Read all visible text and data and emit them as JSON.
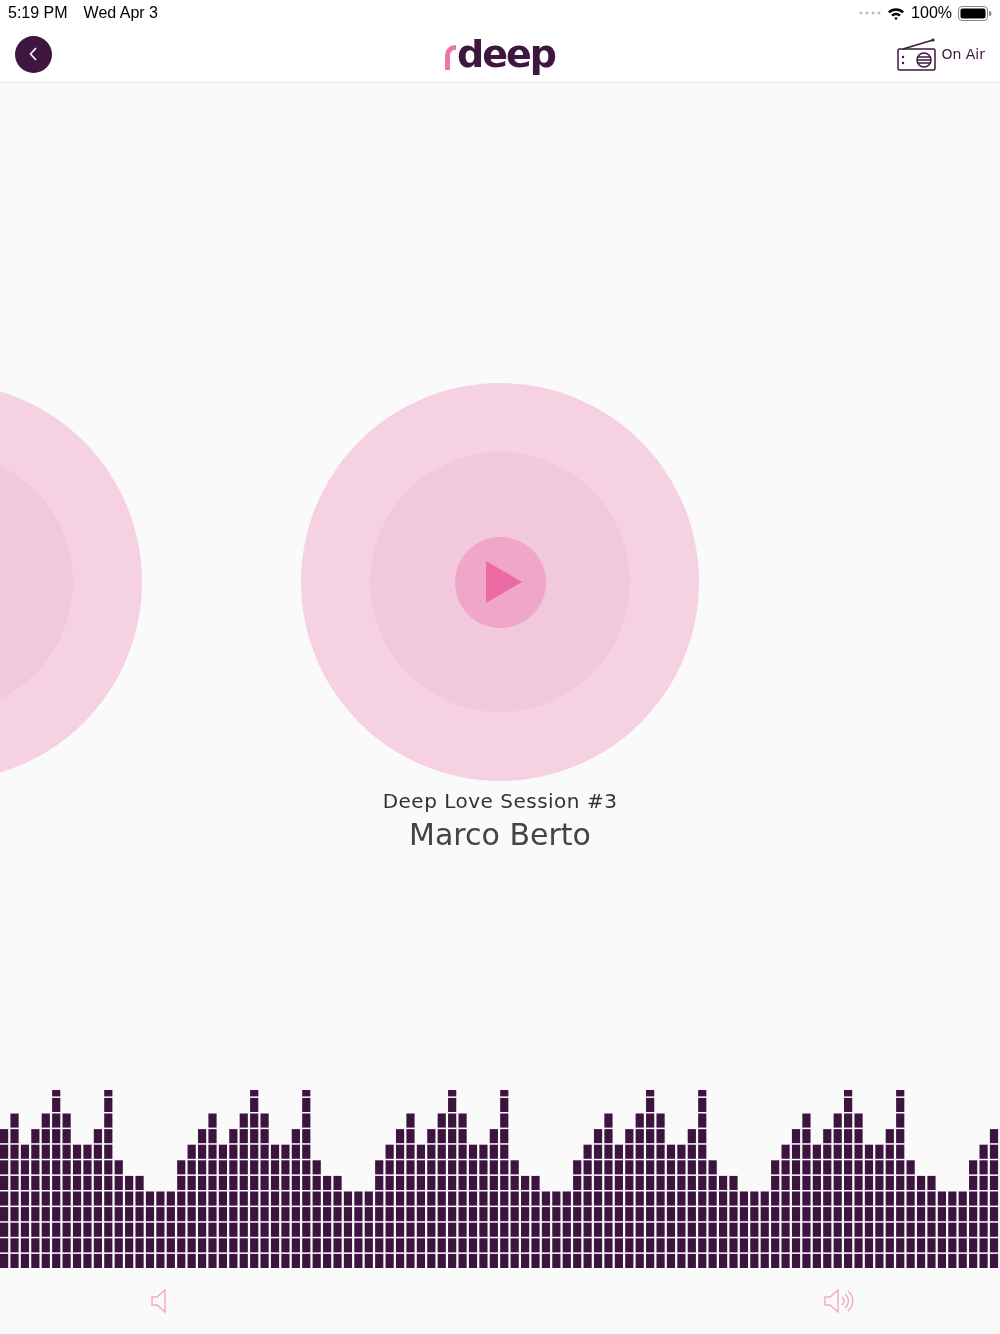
{
  "status_bar": {
    "time": "5:19 PM",
    "date": "Wed Apr 3",
    "battery": "100%"
  },
  "header": {
    "logo": "deep",
    "on_air": "On Air"
  },
  "now_playing": {
    "title": "Deep Love Session #3",
    "artist": "Marco Berto"
  }
}
